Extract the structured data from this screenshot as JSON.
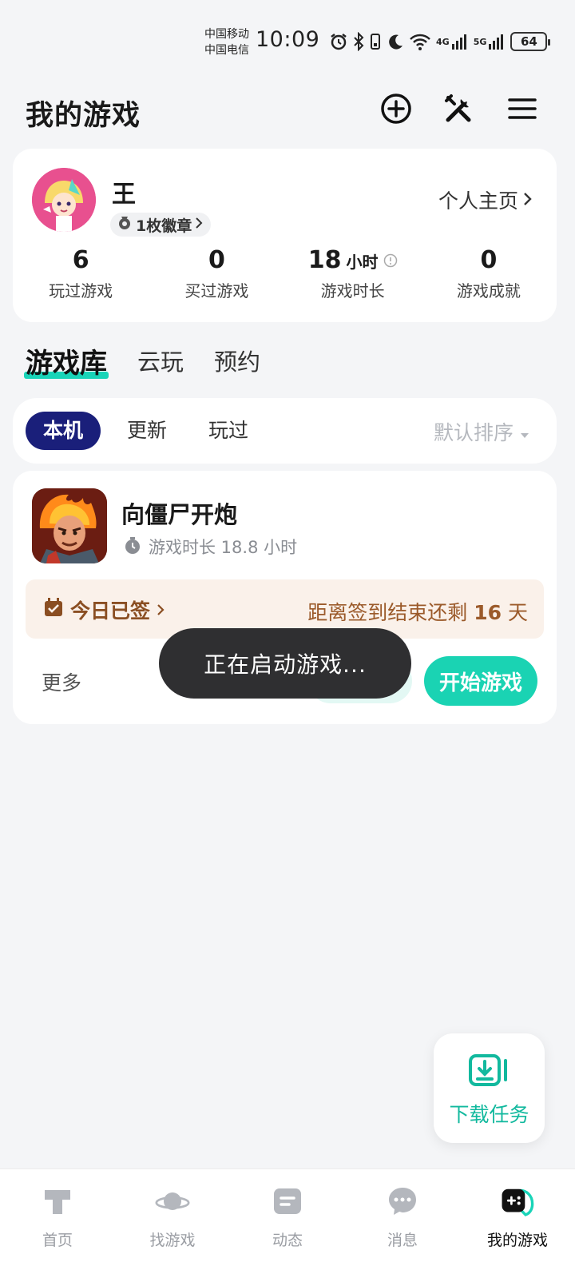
{
  "status_bar": {
    "carrier_1": "中国移动",
    "carrier_2": "中国电信",
    "time": "10:09",
    "net_1": "4G",
    "net_2": "5G",
    "battery": "64",
    "icons": [
      "alarm-icon",
      "bluetooth-icon",
      "vibrate-icon",
      "moon-icon",
      "wifi-icon",
      "signal-icon",
      "signal-icon",
      "battery-icon"
    ]
  },
  "header": {
    "title": "我的游戏",
    "icons": [
      "add-circle-icon",
      "tools-icon",
      "menu-icon"
    ]
  },
  "profile": {
    "name": "王",
    "badge": "1枚徽章",
    "homepage_link": "个人主页",
    "stats": [
      {
        "value": "6",
        "unit": "",
        "label": "玩过游戏"
      },
      {
        "value": "0",
        "unit": "",
        "label": "买过游戏"
      },
      {
        "value": "18",
        "unit": "小时",
        "label": "游戏时长"
      },
      {
        "value": "0",
        "unit": "",
        "label": "游戏成就"
      }
    ]
  },
  "library_tabs": [
    {
      "label": "游戏库",
      "active": true
    },
    {
      "label": "云玩",
      "active": false
    },
    {
      "label": "预约",
      "active": false
    }
  ],
  "filters": [
    {
      "label": "本机",
      "active": true
    },
    {
      "label": "更新",
      "active": false
    },
    {
      "label": "玩过",
      "active": false
    }
  ],
  "sort_label": "默认排序",
  "game": {
    "title": "向僵尸开炮",
    "playtime": "游戏时长 18.8 小时",
    "checkin_status": "今日已签",
    "checkin_remaining_prefix": "距离签到结束还剩",
    "checkin_remaining_days": "16",
    "checkin_remaining_suffix": "天",
    "more_label": "更多",
    "start_label": "开始游戏"
  },
  "toast": "正在启动游戏...",
  "download_float": {
    "label": "下载任务"
  },
  "bottom_nav": [
    {
      "label": "首页",
      "icon": "home-icon",
      "active": false
    },
    {
      "label": "找游戏",
      "icon": "planet-icon",
      "active": false
    },
    {
      "label": "动态",
      "icon": "feed-icon",
      "active": false
    },
    {
      "label": "消息",
      "icon": "chat-icon",
      "active": false
    },
    {
      "label": "我的游戏",
      "icon": "gamepad-icon",
      "active": true
    }
  ],
  "colors": {
    "accent": "#1ad3b3",
    "filter_active": "#1a1f7a",
    "checkin_bg": "#faf1ea",
    "checkin_text": "#8a4e22",
    "toast_bg": "#2f2f31"
  }
}
